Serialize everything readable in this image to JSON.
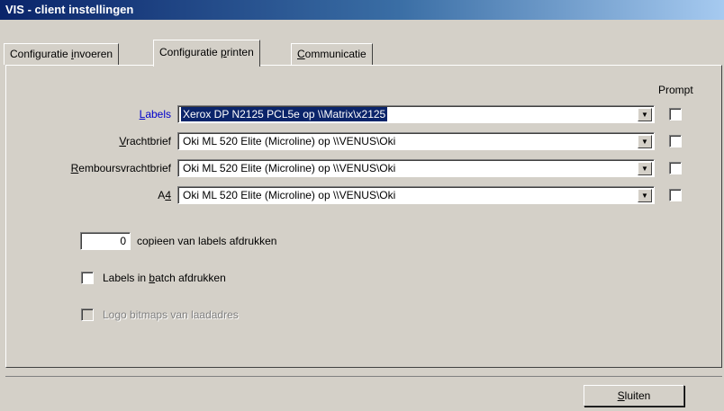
{
  "window": {
    "title": "VIS - client instellingen"
  },
  "tabs": [
    {
      "pre": "Configuratie ",
      "ul": "i",
      "post": "nvoeren"
    },
    {
      "pre": "Configuratie ",
      "ul": "p",
      "post": "rinten"
    },
    {
      "pre": "",
      "ul": "C",
      "post": "ommunicatie"
    }
  ],
  "active_tab": "Configuratie printen",
  "prompt_header": "Prompt",
  "printers": [
    {
      "pre": "",
      "ul": "L",
      "post": "abels",
      "value": "Xerox DP N2125 PCL5e op \\\\Matrix\\x2125",
      "prompt": false
    },
    {
      "pre": "",
      "ul": "V",
      "post": "rachtbrief",
      "value": "Oki ML 520 Elite (Microline) op \\\\VENUS\\Oki",
      "prompt": false
    },
    {
      "pre": "",
      "ul": "R",
      "post": "emboursvrachtbrief",
      "value": "Oki ML 520 Elite (Microline) op \\\\VENUS\\Oki",
      "prompt": false
    },
    {
      "pre": "A",
      "ul": "4",
      "post": "",
      "value": "Oki ML 520 Elite (Microline) op \\\\VENUS\\Oki",
      "prompt": false
    }
  ],
  "copies": {
    "value": "0",
    "label": "copieen van labels afdrukken"
  },
  "batch": {
    "pre": "Labels in ",
    "ul": "b",
    "post": "atch afdrukken",
    "checked": false
  },
  "logo": {
    "label": "Logo bitmaps van laadadres",
    "checked": false,
    "enabled": false
  },
  "close_button": {
    "pre": "",
    "ul": "S",
    "post": "luiten"
  },
  "colors": {
    "title_start": "#0a246a",
    "face": "#d4d0c8",
    "selection": "#0a246a",
    "link_label": "#0000cc"
  }
}
